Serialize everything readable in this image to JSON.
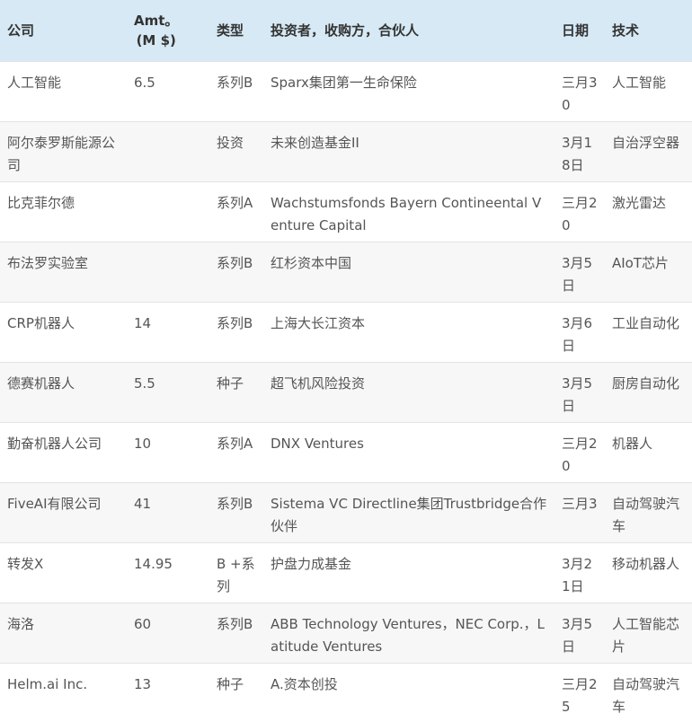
{
  "table": {
    "headers": {
      "company": "公司",
      "amt_line1": "Amt。",
      "amt_line2": "(M $)",
      "type": "类型",
      "investors": "投资者，收购方，合伙人",
      "date": "日期",
      "tech": "技术"
    },
    "rows": [
      {
        "company": "人工智能",
        "amt": "6.5",
        "type": "系列B",
        "investors": "Sparx集团第一生命保险",
        "date": "三月30",
        "tech": "人工智能"
      },
      {
        "company": "阿尔泰罗斯能源公司",
        "amt": "",
        "type": "投资",
        "investors": "未来创造基金II",
        "date": "3月18日",
        "tech": "自治浮空器"
      },
      {
        "company": "比克菲尔德",
        "amt": "",
        "type": "系列A",
        "investors": "Wachstumsfonds Bayern Contineental Venture Capital",
        "date": "三月20",
        "tech": "激光雷达"
      },
      {
        "company": "布法罗实验室",
        "amt": "",
        "type": "系列B",
        "investors": "红杉资本中国",
        "date": "3月5日",
        "tech": "AIoT芯片"
      },
      {
        "company": "CRP机器人",
        "amt": "14",
        "type": "系列B",
        "investors": "上海大长江资本",
        "date": "3月6日",
        "tech": "工业自动化"
      },
      {
        "company": "德赛机器人",
        "amt": "5.5",
        "type": "种子",
        "investors": "超飞机风险投资",
        "date": "3月5日",
        "tech": "厨房自动化"
      },
      {
        "company": "勤奋机器人公司",
        "amt": "10",
        "type": "系列A",
        "investors": "DNX Ventures",
        "date": "三月20",
        "tech": "机器人"
      },
      {
        "company": "FiveAI有限公司",
        "amt": "41",
        "type": "系列B",
        "investors": "Sistema VC Directline集团Trustbridge合作伙伴",
        "date": "三月3",
        "tech": "自动驾驶汽车"
      },
      {
        "company": "转发X",
        "amt": "14.95",
        "type": "B +系列",
        "investors": "护盘力成基金",
        "date": "3月21日",
        "tech": "移动机器人"
      },
      {
        "company": "海洛",
        "amt": "60",
        "type": "系列B",
        "investors": "ABB Technology Ventures，NEC Corp.，Latitude Ventures",
        "date": "3月5日",
        "tech": "人工智能芯片"
      },
      {
        "company": "Helm.ai Inc.",
        "amt": "13",
        "type": "种子",
        "investors": "A.资本创投",
        "date": "三月25",
        "tech": "自动驾驶汽车"
      }
    ]
  }
}
